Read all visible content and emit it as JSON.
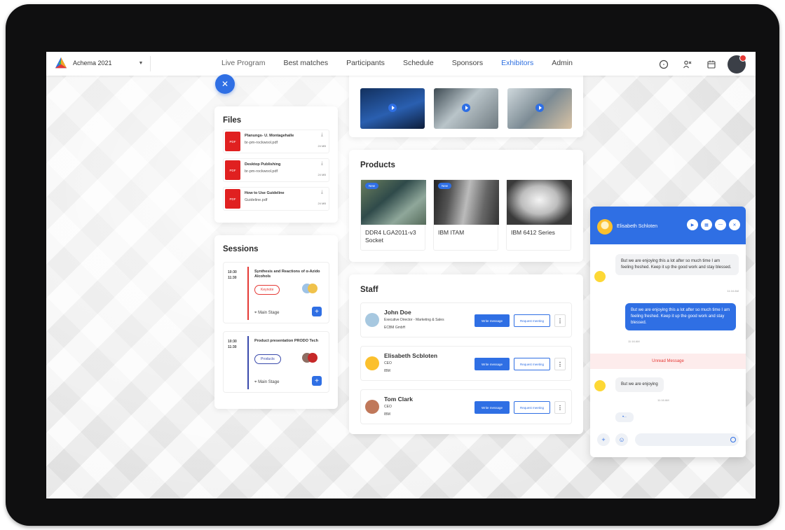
{
  "app": {
    "event_name": "Achema 2021"
  },
  "nav": {
    "items": [
      {
        "label": "Live Program",
        "state": "muted"
      },
      {
        "label": "Best matches",
        "state": "normal"
      },
      {
        "label": "Participants",
        "state": "normal"
      },
      {
        "label": "Schedule",
        "state": "normal"
      },
      {
        "label": "Sponsors",
        "state": "normal"
      },
      {
        "label": "Exhibitors",
        "state": "active"
      },
      {
        "label": "Admin",
        "state": "normal"
      }
    ],
    "icons": [
      "chat-icon",
      "people-icon",
      "calendar-icon"
    ]
  },
  "files": {
    "title": "Files",
    "items": [
      {
        "name": "Planungs- U. Montagehalle",
        "file": "br-pm-rockwool.pdf",
        "size": "24 MB",
        "type": "PDF"
      },
      {
        "name": "Desktop Publishing",
        "file": "br-pm-rockwool.pdf",
        "size": "24 MB",
        "type": "PDF"
      },
      {
        "name": "How to Use Guideline",
        "file": "Guideline.pdf",
        "size": "24 MB",
        "type": "PDF"
      }
    ]
  },
  "sessions": {
    "title": "Sessions",
    "items": [
      {
        "start": "10:30",
        "end": "11:30",
        "title": "Synthesis and Reactions of α-Azido Alcohols",
        "tag": "Keynote",
        "location": "Main Stage",
        "color": "#e53935"
      },
      {
        "start": "10:30",
        "end": "11:30",
        "title": "Product presentation PRODO Tech",
        "tag": "Products",
        "location": "Main Stage",
        "color": "#3949ab"
      }
    ]
  },
  "products": {
    "title": "Products",
    "items": [
      {
        "name": "DDR4 LGA2011-v3 Socket",
        "badge": "New"
      },
      {
        "name": "IBM ITAM",
        "badge": "New"
      },
      {
        "name": "IBM 6412 Series",
        "badge": ""
      }
    ]
  },
  "staff": {
    "title": "Staff",
    "write_label": "Write message",
    "request_label": "Request meeting",
    "members": [
      {
        "name": "John Doe",
        "role": "Executive Director - Marketing & Sales",
        "org": "ECBM GmbH"
      },
      {
        "name": "Elisabeth Scbloten",
        "role": "CEO",
        "org": "IBM"
      },
      {
        "name": "Tom Clark",
        "role": "CEO",
        "org": "IBM"
      }
    ]
  },
  "chat": {
    "contact_name": "Elisabeth Schloten",
    "messages": [
      {
        "dir": "in",
        "text": "But we are enjoying this a lot after so much time I am feeling freshed. Keep it up the good work and stay blessed.",
        "time": "11:16 AM"
      },
      {
        "dir": "out",
        "text": "But we are enjoying this a lot after so much time I am feeling freshed. Keep it up the good work and stay blessed.",
        "time": "11:16 AM"
      },
      {
        "dir": "in",
        "text": "But we are enjoying",
        "time": "11:16 AM"
      }
    ],
    "unread_label": "Unread Message",
    "input_placeholder": ""
  },
  "colors": {
    "accent": "#2f6fe4",
    "pdf_red": "#e02020",
    "unread_red": "#e53935"
  }
}
